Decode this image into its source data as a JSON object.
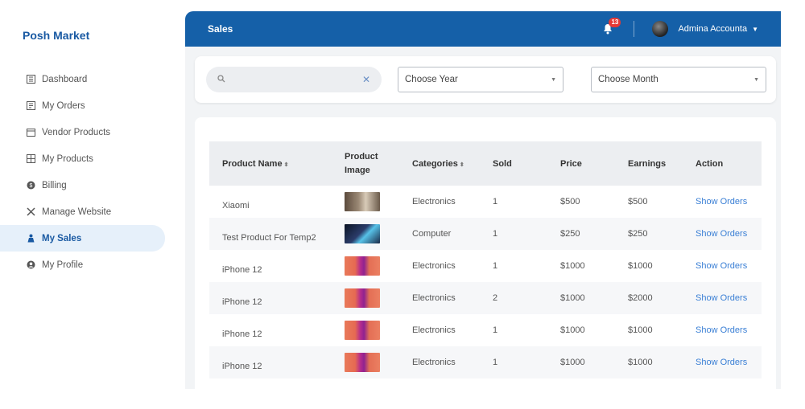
{
  "brand": "Posh Market",
  "nav": [
    {
      "label": "Dashboard",
      "icon": "dashboard-icon",
      "active": false
    },
    {
      "label": "My Orders",
      "icon": "orders-icon",
      "active": false
    },
    {
      "label": "Vendor Products",
      "icon": "vendor-products-icon",
      "active": false
    },
    {
      "label": "My Products",
      "icon": "products-icon",
      "active": false
    },
    {
      "label": "Billing",
      "icon": "billing-icon",
      "active": false
    },
    {
      "label": "Manage Website",
      "icon": "tools-icon",
      "active": false
    },
    {
      "label": "My Sales",
      "icon": "sales-icon",
      "active": true
    },
    {
      "label": "My Profile",
      "icon": "profile-icon",
      "active": false
    }
  ],
  "topbar": {
    "title": "Sales",
    "notification_count": "13",
    "user_name": "Admina Accounta"
  },
  "filters": {
    "search_placeholder": "",
    "search_value": "",
    "year_select": "Choose Year",
    "month_select": "Choose Month"
  },
  "table": {
    "headers": {
      "product_name": "Product Name",
      "product_image": "Product Image",
      "categories": "Categories",
      "sold": "Sold",
      "price": "Price",
      "earnings": "Earnings",
      "action": "Action"
    },
    "rows": [
      {
        "name": "Xiaomi",
        "image": "brown",
        "category": "Electronics",
        "sold": "1",
        "price": "$500",
        "earnings": "$500",
        "action": "Show Orders"
      },
      {
        "name": "Test Product For Temp2",
        "image": "laptop",
        "category": "Computer",
        "sold": "1",
        "price": "$250",
        "earnings": "$250",
        "action": "Show Orders"
      },
      {
        "name": "iPhone 12",
        "image": "phone",
        "category": "Electronics",
        "sold": "1",
        "price": "$1000",
        "earnings": "$1000",
        "action": "Show Orders"
      },
      {
        "name": "iPhone 12",
        "image": "phone",
        "category": "Electronics",
        "sold": "2",
        "price": "$1000",
        "earnings": "$2000",
        "action": "Show Orders"
      },
      {
        "name": "iPhone 12",
        "image": "phone",
        "category": "Electronics",
        "sold": "1",
        "price": "$1000",
        "earnings": "$1000",
        "action": "Show Orders"
      },
      {
        "name": "iPhone 12",
        "image": "phone",
        "category": "Electronics",
        "sold": "1",
        "price": "$1000",
        "earnings": "$1000",
        "action": "Show Orders"
      }
    ]
  },
  "colors": {
    "primary": "#1560a8",
    "brand_text": "#1a5aa3",
    "link": "#3a7fd5",
    "badge": "#e53935",
    "active_nav_bg": "#e6f0fa"
  }
}
